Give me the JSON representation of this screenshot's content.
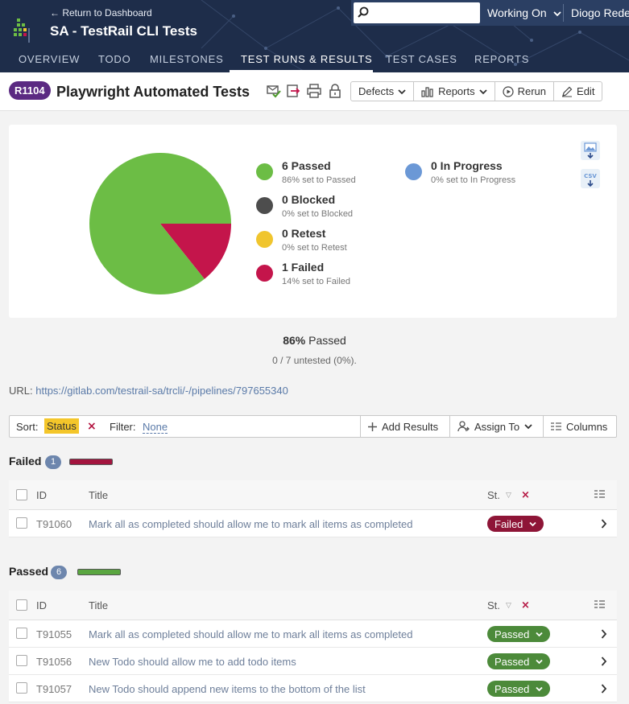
{
  "header": {
    "return_link": "← Return to Dashboard",
    "project_title": "SA - TestRail CLI Tests",
    "search_placeholder": "",
    "working_on": "Working On",
    "user_name": "Diogo Rede",
    "nav_tabs": [
      "OVERVIEW",
      "TODO",
      "MILESTONES",
      "TEST RUNS & RESULTS",
      "TEST CASES",
      "REPORTS"
    ],
    "active_tab": "TEST RUNS & RESULTS"
  },
  "run": {
    "badge": "R1104",
    "title": "Playwright Automated Tests",
    "buttons": {
      "defects": "Defects",
      "reports": "Reports",
      "rerun": "Rerun",
      "edit": "Edit"
    }
  },
  "chart_data": {
    "type": "pie",
    "categories": [
      "Passed",
      "Failed"
    ],
    "values": [
      6,
      1
    ],
    "colors": [
      "#6cbd45",
      "#c4154b"
    ]
  },
  "legend": [
    {
      "label": "6 Passed",
      "sub": "86% set to Passed",
      "color": "#6cbd45"
    },
    {
      "label": "0 Blocked",
      "sub": "0% set to Blocked",
      "color": "#4d4d4d"
    },
    {
      "label": "0 Retest",
      "sub": "0% set to Retest",
      "color": "#f0c52e"
    },
    {
      "label": "1 Failed",
      "sub": "14% set to Failed",
      "color": "#c4154b"
    },
    {
      "label": "0 In Progress",
      "sub": "0% set to In Progress",
      "color": "#6b98d6"
    }
  ],
  "download_icons": [
    "image-download-icon",
    "csv-download-icon"
  ],
  "summary": {
    "pct": "86%",
    "pct_label": "Passed",
    "untested": "0 / 7 untested (0%)."
  },
  "url": {
    "label": "URL:",
    "href": "https://gitlab.com/testrail-sa/trcli/-/pipelines/797655340"
  },
  "filter_bar": {
    "sort_label": "Sort:",
    "sort_value": "Status",
    "filter_label": "Filter:",
    "filter_value": "None",
    "add_results": "Add Results",
    "assign_to": "Assign To",
    "columns": "Columns"
  },
  "table_headers": {
    "id": "ID",
    "title": "Title",
    "status": "St."
  },
  "sections": [
    {
      "title": "Failed",
      "count": "1",
      "bar_color": "#a3143e",
      "rows": [
        {
          "id": "T91060",
          "title": "Mark all as completed should allow me to mark all items as completed",
          "status": "Failed",
          "kind": "failed"
        }
      ]
    },
    {
      "title": "Passed",
      "count": "6",
      "bar_color": "#5aa640",
      "rows": [
        {
          "id": "T91055",
          "title": "Mark all as completed should allow me to mark all items as completed",
          "status": "Passed",
          "kind": "passed"
        },
        {
          "id": "T91056",
          "title": "New Todo should allow me to add todo items",
          "status": "Passed",
          "kind": "passed"
        },
        {
          "id": "T91057",
          "title": "New Todo should append new items to the bottom of the list",
          "status": "Passed",
          "kind": "passed"
        }
      ]
    }
  ]
}
